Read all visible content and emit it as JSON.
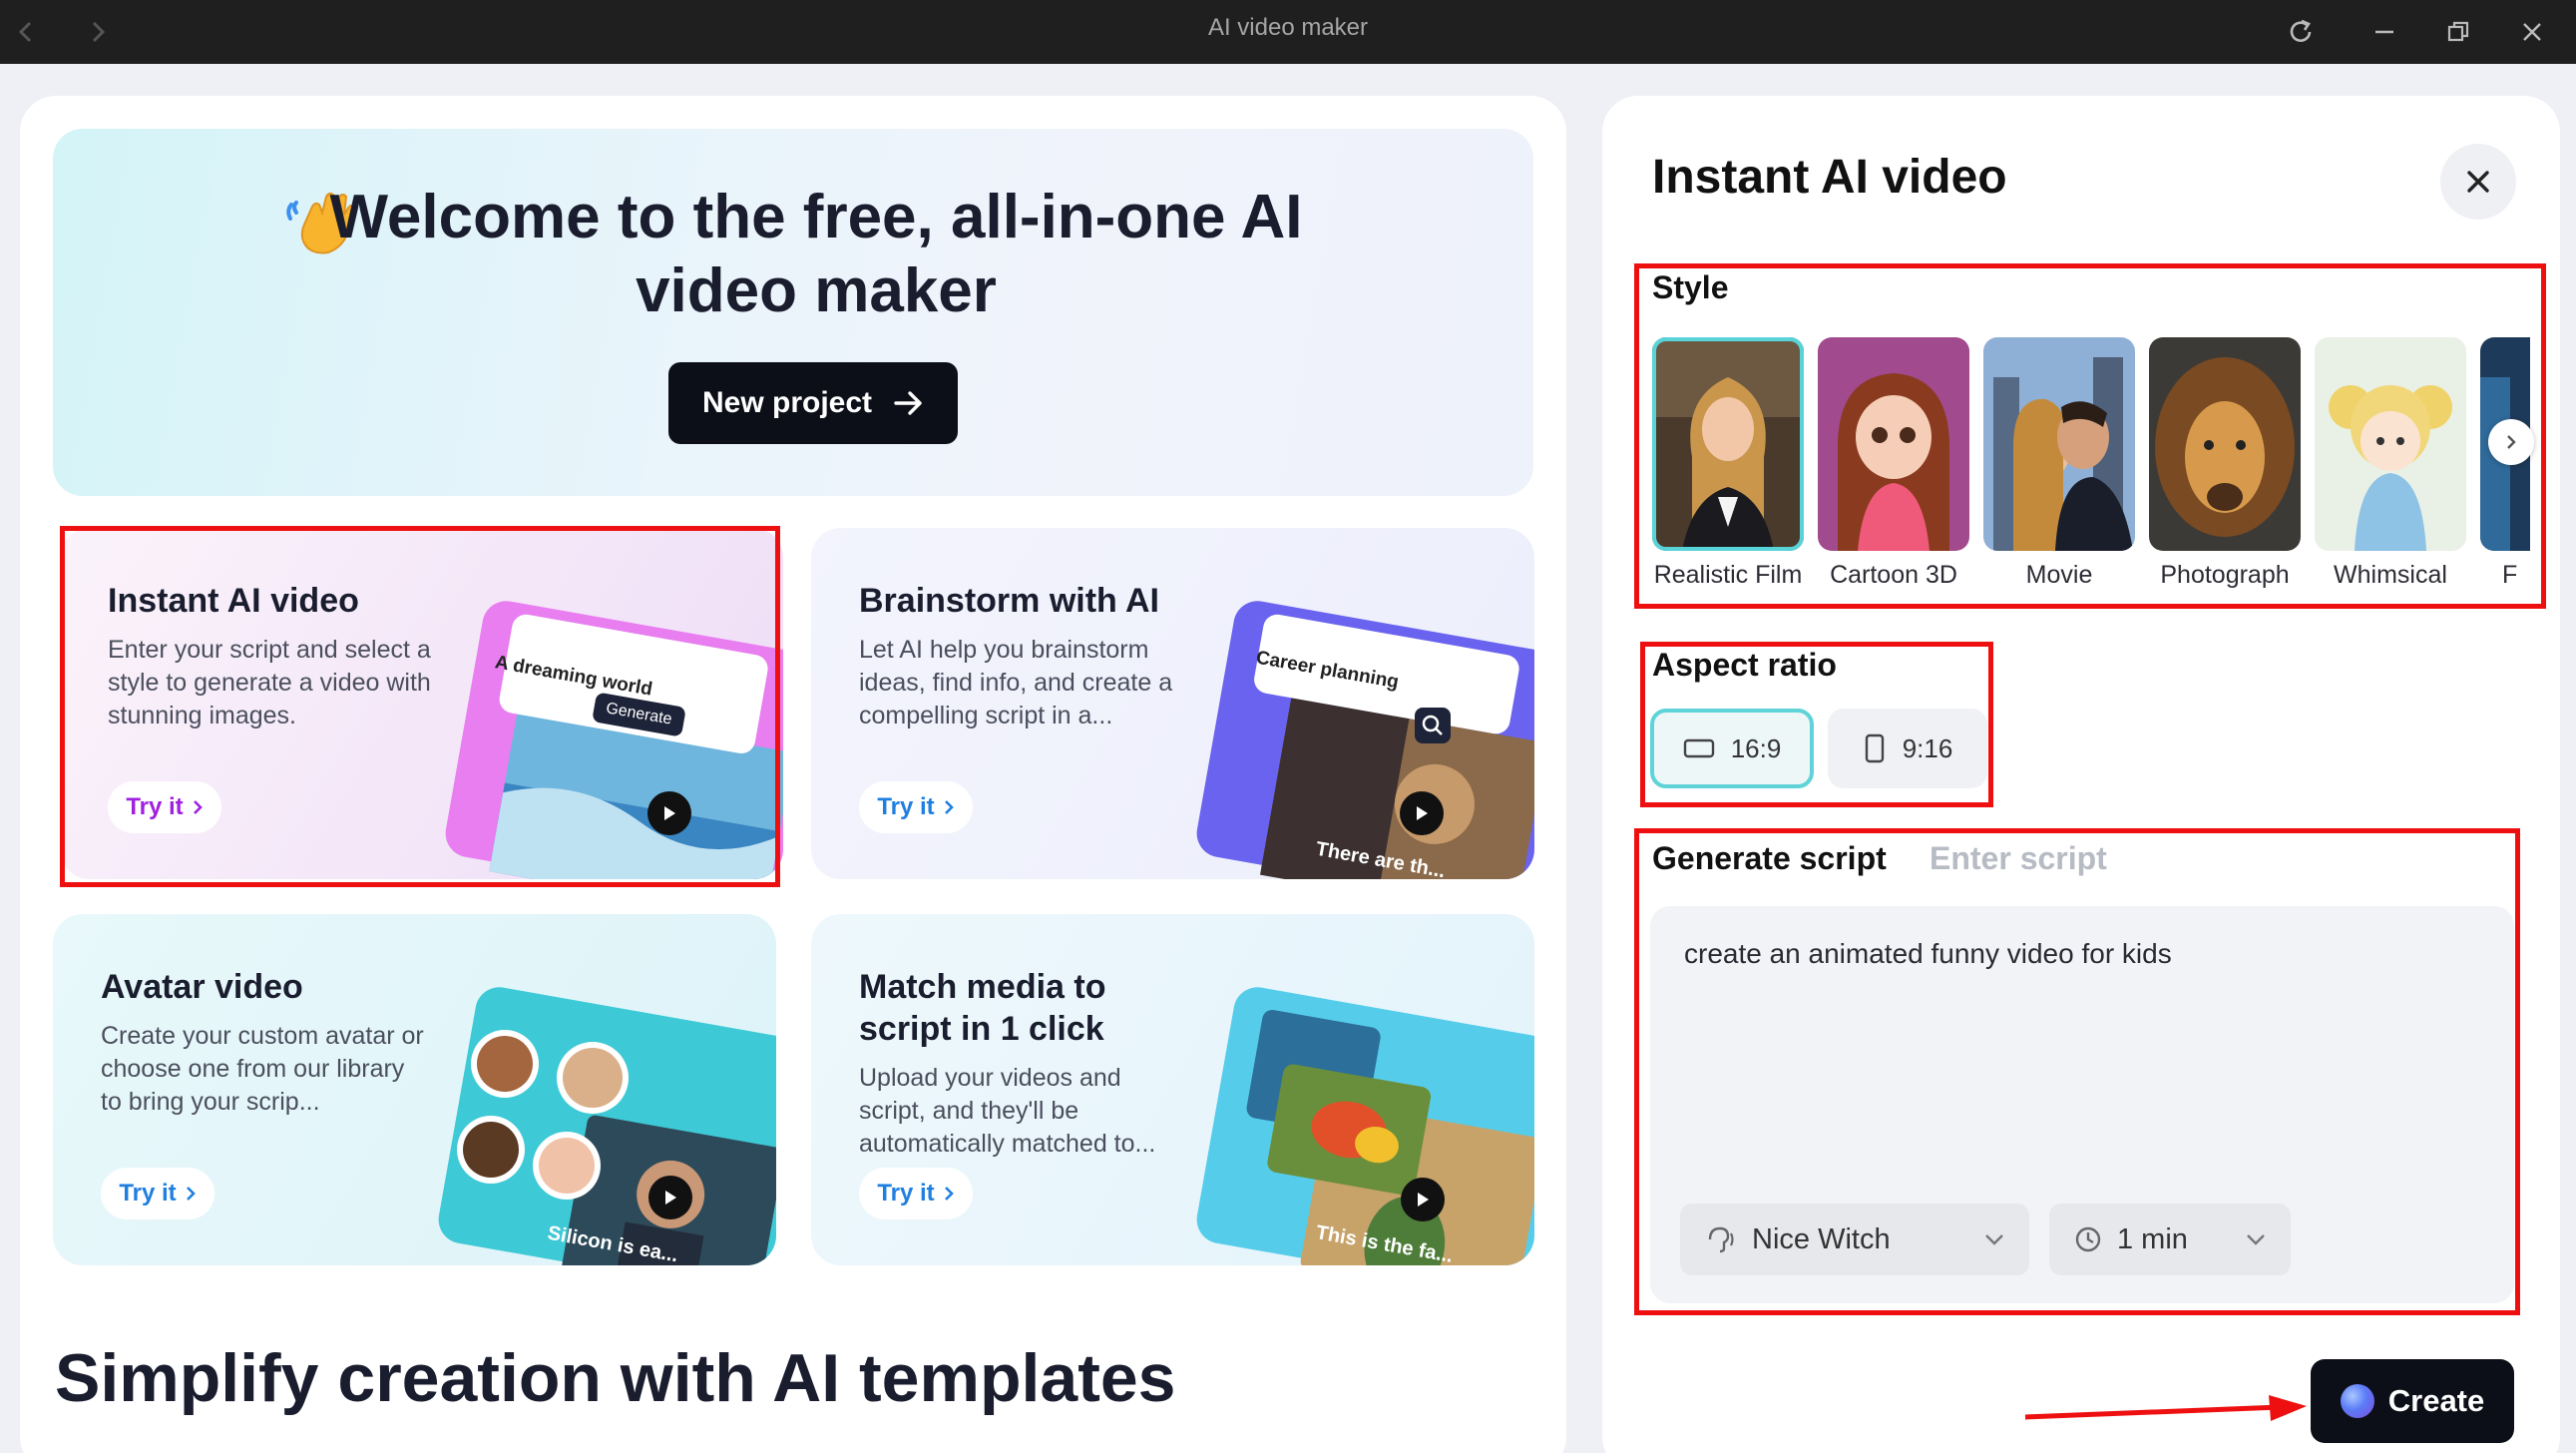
{
  "window": {
    "title": "AI video maker"
  },
  "hero": {
    "title": "Welcome to the free, all-in-one AI video maker",
    "new_project_label": "New project"
  },
  "cards": [
    {
      "title": "Instant AI video",
      "description": "Enter your script and select a style to generate a video with stunning images.",
      "try_label": "Try it",
      "art_prompt": "A dreaming world",
      "art_button": "Generate"
    },
    {
      "title": "Brainstorm with AI",
      "description": "Let AI help you brainstorm ideas, find info, and create a compelling script in a...",
      "try_label": "Try it",
      "art_prompt": "Career planning",
      "art_caption": "There are th..."
    },
    {
      "title": "Avatar video",
      "description": "Create your custom avatar or choose one from our library to bring your scrip...",
      "try_label": "Try it",
      "art_caption": "Silicon is ea..."
    },
    {
      "title": "Match media to script in 1 click",
      "description": "Upload your videos and script, and they'll be automatically matched to...",
      "try_label": "Try it",
      "art_caption": "This is the fa..."
    }
  ],
  "templates_section": {
    "title": "Simplify creation with AI templates"
  },
  "panel": {
    "title": "Instant AI video",
    "style": {
      "label": "Style",
      "items": [
        {
          "name": "Realistic Film",
          "selected": true
        },
        {
          "name": "Cartoon 3D",
          "selected": false
        },
        {
          "name": "Movie",
          "selected": false
        },
        {
          "name": "Photograph",
          "selected": false
        },
        {
          "name": "Whimsical",
          "selected": false
        },
        {
          "name": "F",
          "selected": false
        }
      ]
    },
    "aspect_ratio": {
      "label": "Aspect ratio",
      "options": [
        {
          "label": "16:9",
          "selected": true
        },
        {
          "label": "9:16",
          "selected": false
        }
      ]
    },
    "script": {
      "tabs": [
        "Generate script",
        "Enter script"
      ],
      "active_tab": "Generate script",
      "value": "create an animated funny video for kids",
      "voice": "Nice Witch",
      "duration": "1 min"
    },
    "create_label": "Create"
  },
  "colors": {
    "accent_teal": "#5fd3d8",
    "try_it_purple": "#a020e0",
    "try_it_blue": "#1f7fe0",
    "annotation_red": "#ee1010",
    "button_dark": "#0d0f18"
  }
}
